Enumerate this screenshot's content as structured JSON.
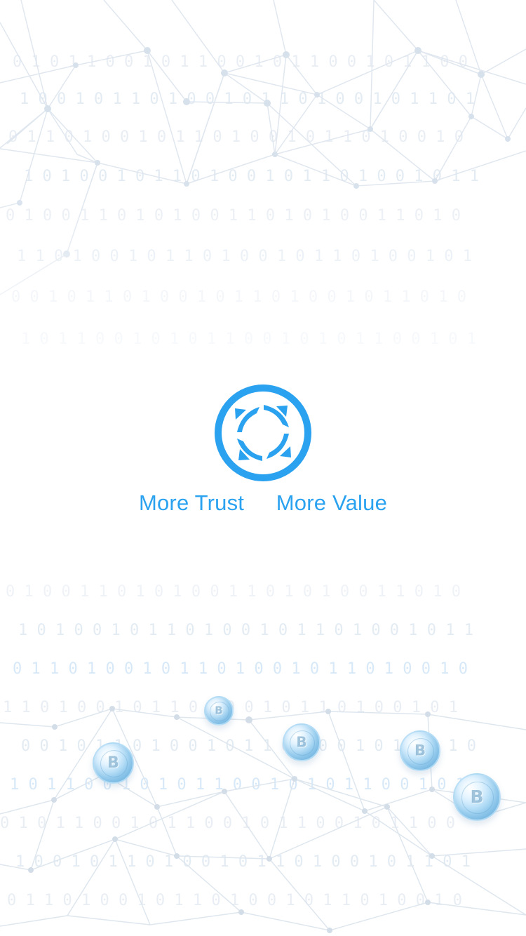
{
  "app": {
    "screen": "splash",
    "slogan_left": "More Trust",
    "slogan_right": "More Value"
  },
  "brand": {
    "logo_icon": "circular-arrows-logo-icon",
    "accent_color": "#2aa2f0",
    "background_color": "#ffffff"
  },
  "background": {
    "pattern": "network-lines-and-binary-digits",
    "coin_icon": "bitcoin-coin-icon",
    "coin_symbol": "B"
  }
}
